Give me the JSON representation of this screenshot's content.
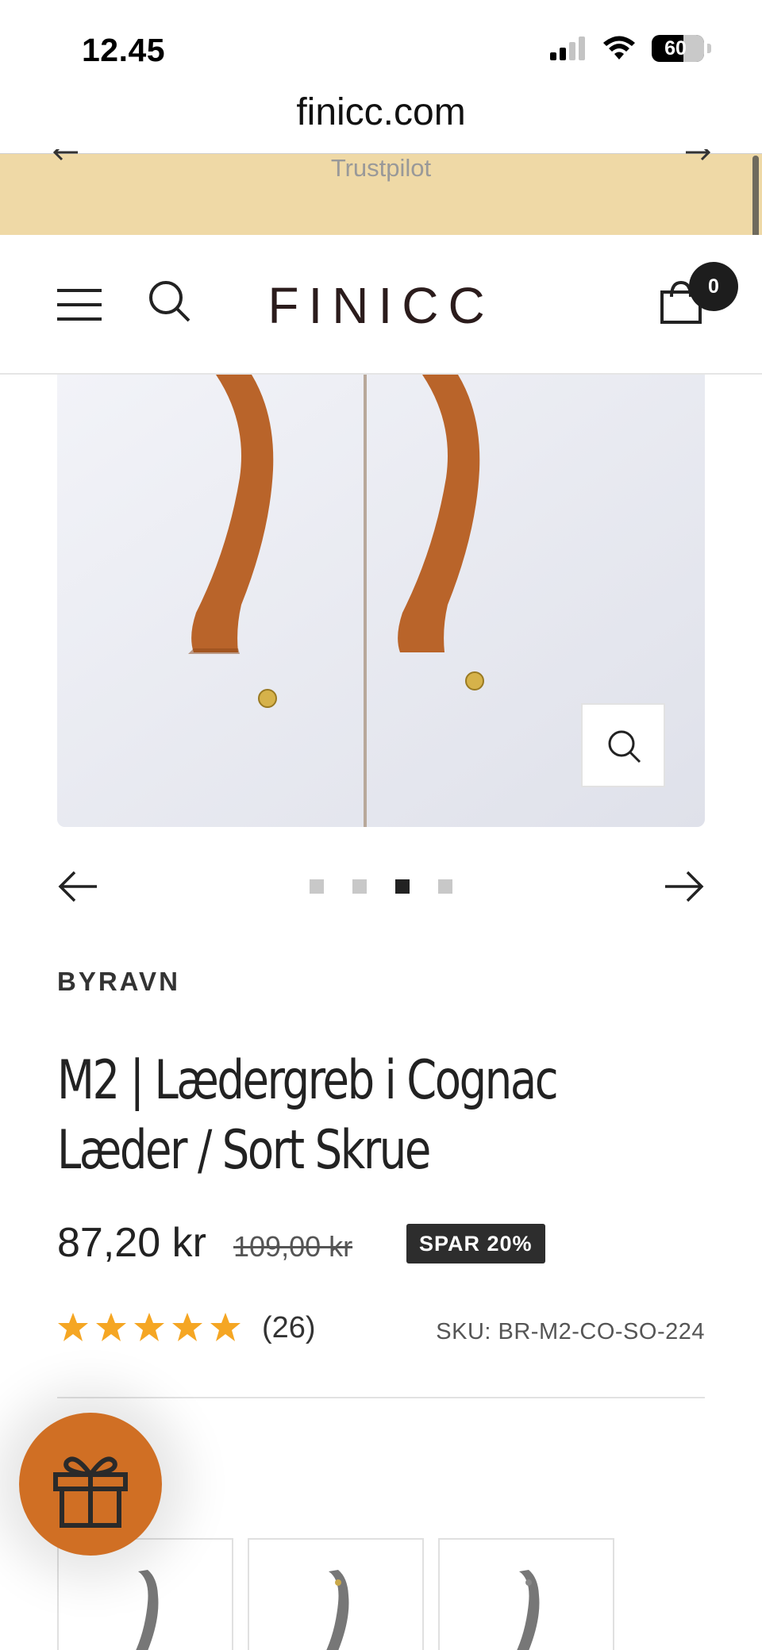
{
  "status_bar": {
    "time": "12.45",
    "battery": "60",
    "signal_icon": "cellular-signal-icon",
    "wifi_icon": "wifi-icon"
  },
  "browser": {
    "url": "finicc.com"
  },
  "announcement": {
    "text": "Trustpilot",
    "background": "#efd9a6"
  },
  "header": {
    "logo": "FINICC",
    "cart_count": "0"
  },
  "gallery": {
    "slide_count": 4,
    "active_slide": 3
  },
  "product": {
    "vendor": "BYRAVN",
    "title": "M2 | Lædergreb i Cognac Læder / Sort Skrue",
    "price": "87,20 kr",
    "compare_price": "109,00 kr",
    "save_badge": "SPAR 20%",
    "rating": 5,
    "review_count": "(26)",
    "sku": "SKU: BR-M2-CO-SO-224",
    "option_label": ":"
  },
  "colors": {
    "accent_orange": "#d06f24",
    "star": "#f5a623",
    "leather": "#b9642a",
    "badge": "#2d2d2d"
  }
}
